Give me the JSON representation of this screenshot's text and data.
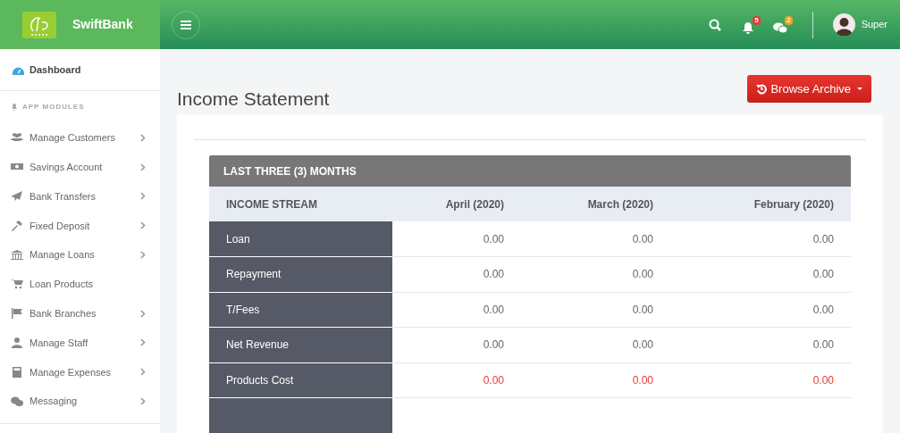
{
  "brand": {
    "name": "SwiftBank"
  },
  "topbar": {
    "notifications": "5",
    "messages": "2",
    "user": "Super"
  },
  "sidebar": {
    "dashboard": "Dashboard",
    "section": "APP MODULES",
    "items": [
      {
        "label": "Manage Customers",
        "has_submenu": true
      },
      {
        "label": "Savings Account",
        "has_submenu": true
      },
      {
        "label": "Bank Transfers",
        "has_submenu": true
      },
      {
        "label": "Fixed Deposit",
        "has_submenu": true
      },
      {
        "label": "Manage Loans",
        "has_submenu": true
      },
      {
        "label": "Loan Products",
        "has_submenu": false
      },
      {
        "label": "Bank Branches",
        "has_submenu": true
      },
      {
        "label": "Manage Staff",
        "has_submenu": true
      },
      {
        "label": "Manage Expenses",
        "has_submenu": true
      },
      {
        "label": "Messaging",
        "has_submenu": true
      }
    ]
  },
  "page": {
    "title": "Income Statement",
    "archive_button": "Browse Archive"
  },
  "table": {
    "caption": "LAST THREE (3) MONTHS",
    "columns": [
      "INCOME STREAM",
      "April (2020)",
      "March (2020)",
      "February (2020)"
    ],
    "rows": [
      {
        "label": "Loan",
        "kind": "income",
        "values": [
          "0.00",
          "0.00",
          "0.00"
        ]
      },
      {
        "label": "Repayment",
        "kind": "income",
        "values": [
          "0.00",
          "0.00",
          "0.00"
        ]
      },
      {
        "label": "T/Fees",
        "kind": "income",
        "values": [
          "0.00",
          "0.00",
          "0.00"
        ]
      },
      {
        "label": "Net Revenue",
        "kind": "income",
        "values": [
          "0.00",
          "0.00",
          "0.00"
        ]
      },
      {
        "label": "Products Cost",
        "kind": "cost",
        "values": [
          "0.00",
          "0.00",
          "0.00"
        ]
      }
    ]
  }
}
